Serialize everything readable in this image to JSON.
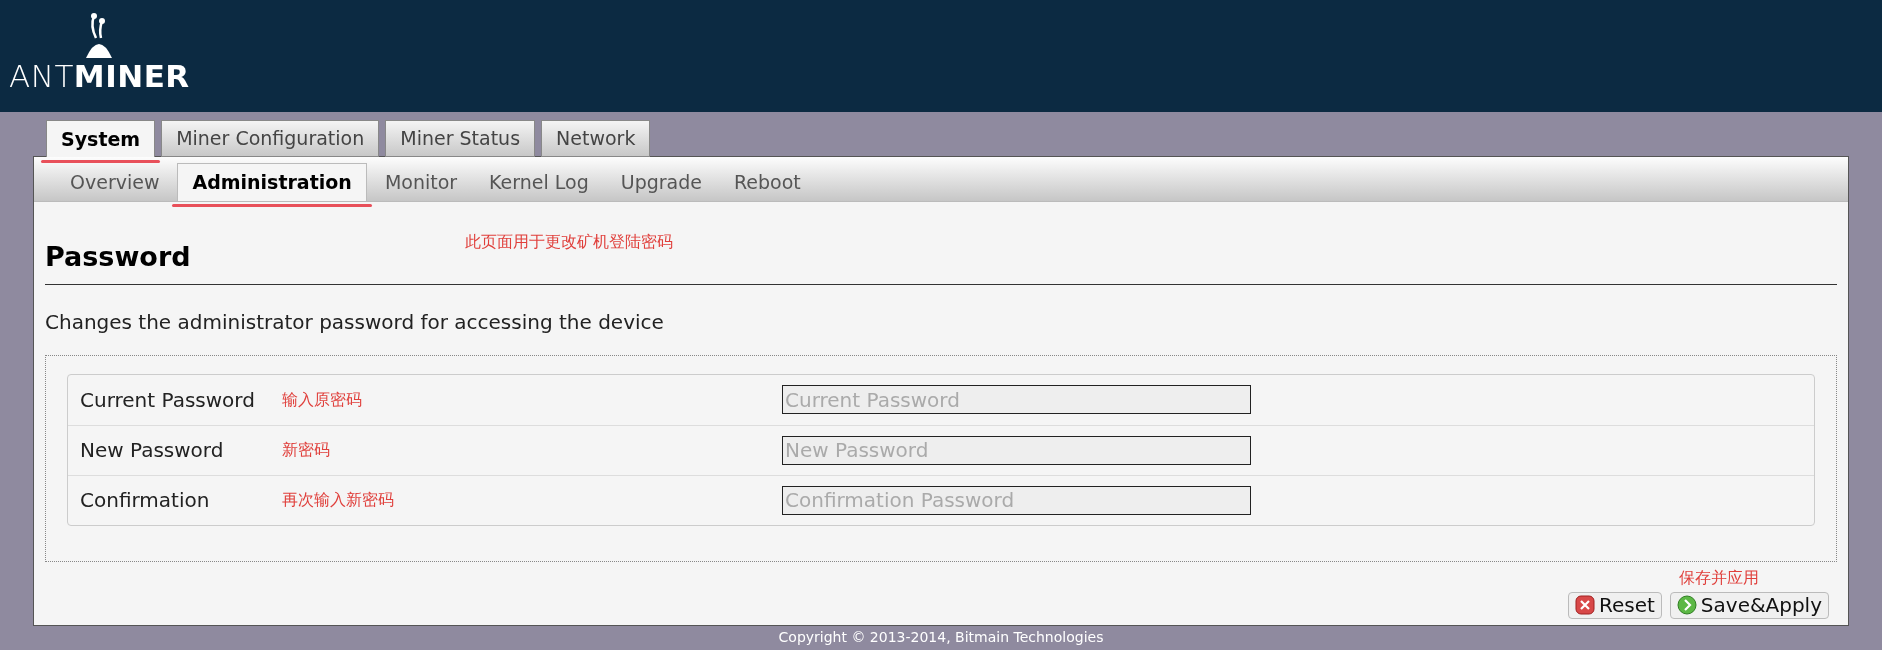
{
  "logo": {
    "light": "ANT",
    "bold": "MINER"
  },
  "tabs": [
    {
      "label": "System",
      "selected": true,
      "annotated": true
    },
    {
      "label": "Miner Configuration",
      "selected": false,
      "annotated": false
    },
    {
      "label": "Miner Status",
      "selected": false,
      "annotated": false
    },
    {
      "label": "Network",
      "selected": false,
      "annotated": false
    }
  ],
  "subtabs": [
    {
      "label": "Overview",
      "selected": false,
      "annotated": false
    },
    {
      "label": "Administration",
      "selected": true,
      "annotated": true
    },
    {
      "label": "Monitor",
      "selected": false,
      "annotated": false
    },
    {
      "label": "Kernel Log",
      "selected": false,
      "annotated": false
    },
    {
      "label": "Upgrade",
      "selected": false,
      "annotated": false
    },
    {
      "label": "Reboot",
      "selected": false,
      "annotated": false
    }
  ],
  "page_note": "此页面用于更改矿机登陆密码",
  "section": {
    "title": "Password",
    "description": "Changes the administrator password for accessing the device"
  },
  "fields": [
    {
      "label": "Current Password",
      "note": "输入原密码",
      "placeholder": "Current Password"
    },
    {
      "label": "New Password",
      "note": "新密码",
      "placeholder": "New Password"
    },
    {
      "label": "Confirmation",
      "note": "再次输入新密码",
      "placeholder": "Confirmation Password"
    }
  ],
  "buttons_note": "保存并应用",
  "buttons": [
    {
      "kind": "reset",
      "label": "Reset"
    },
    {
      "kind": "save",
      "label": "Save&Apply"
    }
  ],
  "footer": "Copyright © 2013-2014, Bitmain Technologies"
}
